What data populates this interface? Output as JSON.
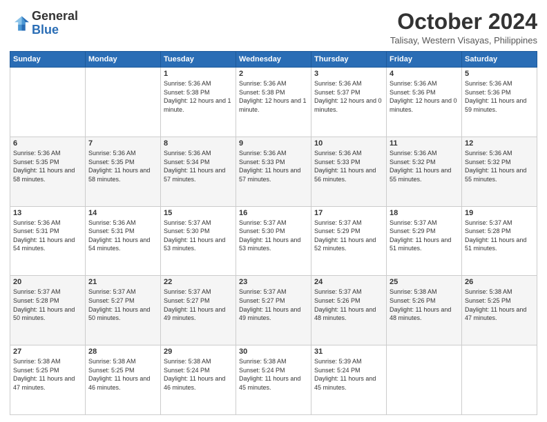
{
  "header": {
    "logo": {
      "general": "General",
      "blue": "Blue"
    },
    "title": "October 2024",
    "location": "Talisay, Western Visayas, Philippines"
  },
  "days_header": [
    "Sunday",
    "Monday",
    "Tuesday",
    "Wednesday",
    "Thursday",
    "Friday",
    "Saturday"
  ],
  "weeks": [
    [
      {
        "day": "",
        "content": ""
      },
      {
        "day": "",
        "content": ""
      },
      {
        "day": "1",
        "content": "Sunrise: 5:36 AM\nSunset: 5:38 PM\nDaylight: 12 hours\nand 1 minute."
      },
      {
        "day": "2",
        "content": "Sunrise: 5:36 AM\nSunset: 5:38 PM\nDaylight: 12 hours\nand 1 minute."
      },
      {
        "day": "3",
        "content": "Sunrise: 5:36 AM\nSunset: 5:37 PM\nDaylight: 12 hours\nand 0 minutes."
      },
      {
        "day": "4",
        "content": "Sunrise: 5:36 AM\nSunset: 5:36 PM\nDaylight: 12 hours\nand 0 minutes."
      },
      {
        "day": "5",
        "content": "Sunrise: 5:36 AM\nSunset: 5:36 PM\nDaylight: 11 hours\nand 59 minutes."
      }
    ],
    [
      {
        "day": "6",
        "content": "Sunrise: 5:36 AM\nSunset: 5:35 PM\nDaylight: 11 hours\nand 58 minutes."
      },
      {
        "day": "7",
        "content": "Sunrise: 5:36 AM\nSunset: 5:35 PM\nDaylight: 11 hours\nand 58 minutes."
      },
      {
        "day": "8",
        "content": "Sunrise: 5:36 AM\nSunset: 5:34 PM\nDaylight: 11 hours\nand 57 minutes."
      },
      {
        "day": "9",
        "content": "Sunrise: 5:36 AM\nSunset: 5:33 PM\nDaylight: 11 hours\nand 57 minutes."
      },
      {
        "day": "10",
        "content": "Sunrise: 5:36 AM\nSunset: 5:33 PM\nDaylight: 11 hours\nand 56 minutes."
      },
      {
        "day": "11",
        "content": "Sunrise: 5:36 AM\nSunset: 5:32 PM\nDaylight: 11 hours\nand 55 minutes."
      },
      {
        "day": "12",
        "content": "Sunrise: 5:36 AM\nSunset: 5:32 PM\nDaylight: 11 hours\nand 55 minutes."
      }
    ],
    [
      {
        "day": "13",
        "content": "Sunrise: 5:36 AM\nSunset: 5:31 PM\nDaylight: 11 hours\nand 54 minutes."
      },
      {
        "day": "14",
        "content": "Sunrise: 5:36 AM\nSunset: 5:31 PM\nDaylight: 11 hours\nand 54 minutes."
      },
      {
        "day": "15",
        "content": "Sunrise: 5:37 AM\nSunset: 5:30 PM\nDaylight: 11 hours\nand 53 minutes."
      },
      {
        "day": "16",
        "content": "Sunrise: 5:37 AM\nSunset: 5:30 PM\nDaylight: 11 hours\nand 53 minutes."
      },
      {
        "day": "17",
        "content": "Sunrise: 5:37 AM\nSunset: 5:29 PM\nDaylight: 11 hours\nand 52 minutes."
      },
      {
        "day": "18",
        "content": "Sunrise: 5:37 AM\nSunset: 5:29 PM\nDaylight: 11 hours\nand 51 minutes."
      },
      {
        "day": "19",
        "content": "Sunrise: 5:37 AM\nSunset: 5:28 PM\nDaylight: 11 hours\nand 51 minutes."
      }
    ],
    [
      {
        "day": "20",
        "content": "Sunrise: 5:37 AM\nSunset: 5:28 PM\nDaylight: 11 hours\nand 50 minutes."
      },
      {
        "day": "21",
        "content": "Sunrise: 5:37 AM\nSunset: 5:27 PM\nDaylight: 11 hours\nand 50 minutes."
      },
      {
        "day": "22",
        "content": "Sunrise: 5:37 AM\nSunset: 5:27 PM\nDaylight: 11 hours\nand 49 minutes."
      },
      {
        "day": "23",
        "content": "Sunrise: 5:37 AM\nSunset: 5:27 PM\nDaylight: 11 hours\nand 49 minutes."
      },
      {
        "day": "24",
        "content": "Sunrise: 5:37 AM\nSunset: 5:26 PM\nDaylight: 11 hours\nand 48 minutes."
      },
      {
        "day": "25",
        "content": "Sunrise: 5:38 AM\nSunset: 5:26 PM\nDaylight: 11 hours\nand 48 minutes."
      },
      {
        "day": "26",
        "content": "Sunrise: 5:38 AM\nSunset: 5:25 PM\nDaylight: 11 hours\nand 47 minutes."
      }
    ],
    [
      {
        "day": "27",
        "content": "Sunrise: 5:38 AM\nSunset: 5:25 PM\nDaylight: 11 hours\nand 47 minutes."
      },
      {
        "day": "28",
        "content": "Sunrise: 5:38 AM\nSunset: 5:25 PM\nDaylight: 11 hours\nand 46 minutes."
      },
      {
        "day": "29",
        "content": "Sunrise: 5:38 AM\nSunset: 5:24 PM\nDaylight: 11 hours\nand 46 minutes."
      },
      {
        "day": "30",
        "content": "Sunrise: 5:38 AM\nSunset: 5:24 PM\nDaylight: 11 hours\nand 45 minutes."
      },
      {
        "day": "31",
        "content": "Sunrise: 5:39 AM\nSunset: 5:24 PM\nDaylight: 11 hours\nand 45 minutes."
      },
      {
        "day": "",
        "content": ""
      },
      {
        "day": "",
        "content": ""
      }
    ]
  ]
}
